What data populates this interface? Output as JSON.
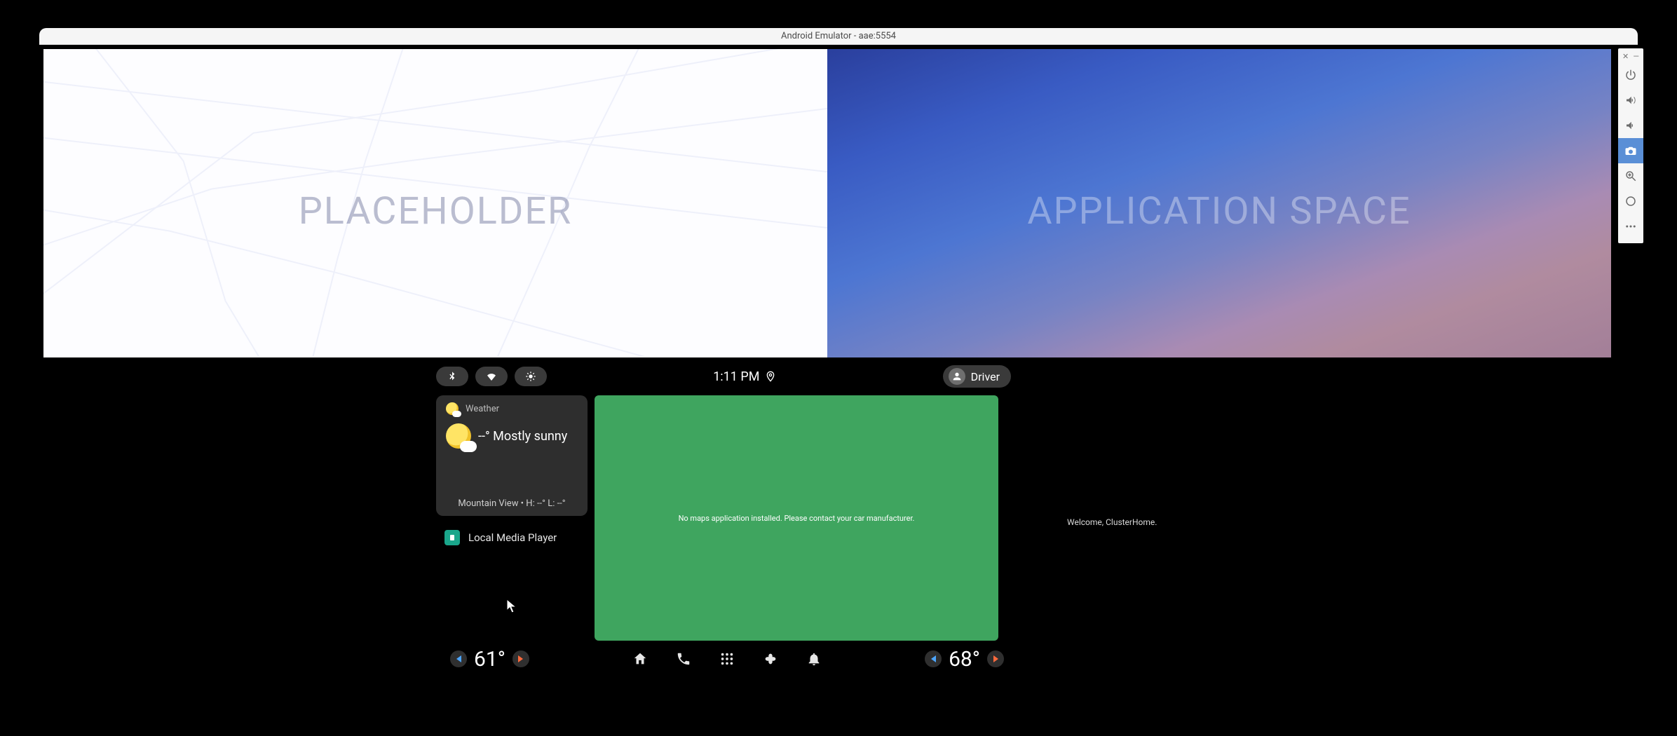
{
  "window": {
    "title": "Android Emulator - aae:5554"
  },
  "top_panels": {
    "left_label": "PLACEHOLDER",
    "right_label": "APPLICATION SPACE"
  },
  "statusbar": {
    "time": "1:11 PM",
    "profile_name": "Driver",
    "toggles": {
      "bluetooth": "bluetooth-icon",
      "wifi": "wifi-icon",
      "brightness": "brightness-icon"
    }
  },
  "weather": {
    "card_title": "Weather",
    "condition_line": "--° Mostly sunny",
    "footer": "Mountain View • H: --° L: --°"
  },
  "media_row": {
    "label": "Local Media Player"
  },
  "map_card": {
    "message": "No maps application installed. Please contact your car manufacturer."
  },
  "cluster": {
    "welcome": "Welcome, ClusterHome."
  },
  "navbar": {
    "left_temp": "61°",
    "right_temp": "68°",
    "icons": [
      "home-icon",
      "phone-icon",
      "apps-icon",
      "fan-icon",
      "bell-icon"
    ]
  },
  "emu_toolbar": {
    "small": [
      "close-icon",
      "minimize-icon"
    ],
    "buttons": [
      "power-icon",
      "volume-up-icon",
      "volume-down-icon",
      "camera-icon",
      "zoom-icon",
      "home-circle-icon",
      "more-icon"
    ],
    "active": "camera-icon"
  }
}
